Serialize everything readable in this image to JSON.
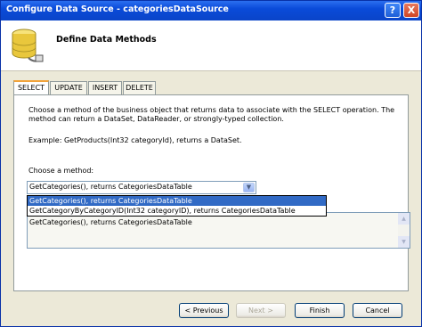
{
  "window": {
    "title": "Configure Data Source - categoriesDataSource",
    "help_label": "?",
    "close_label": "X"
  },
  "header": {
    "title": "Define Data Methods"
  },
  "tabs": [
    {
      "label": "SELECT"
    },
    {
      "label": "UPDATE"
    },
    {
      "label": "INSERT"
    },
    {
      "label": "DELETE"
    }
  ],
  "panel": {
    "description": "Choose a method of the business object that returns data to associate with the SELECT operation. The method can return a DataSet, DataReader, or strongly-typed collection.",
    "example": "Example: GetProducts(Int32 categoryId), returns a DataSet.",
    "choose_label": "Choose a method:",
    "method_value": "GetCategories(), returns CategoriesDataTable",
    "method_options": [
      "GetCategories(), returns CategoriesDataTable",
      "GetCategoryByCategoryID(Int32 categoryID), returns CategoriesDataTable"
    ],
    "signature": "GetCategories(), returns CategoriesDataTable"
  },
  "buttons": {
    "previous": "< Previous",
    "next": "Next >",
    "finish": "Finish",
    "cancel": "Cancel"
  },
  "colors": {
    "titlebar": "#0a4bd9",
    "selection": "#316ac5",
    "tab_accent": "#f2a33a"
  }
}
